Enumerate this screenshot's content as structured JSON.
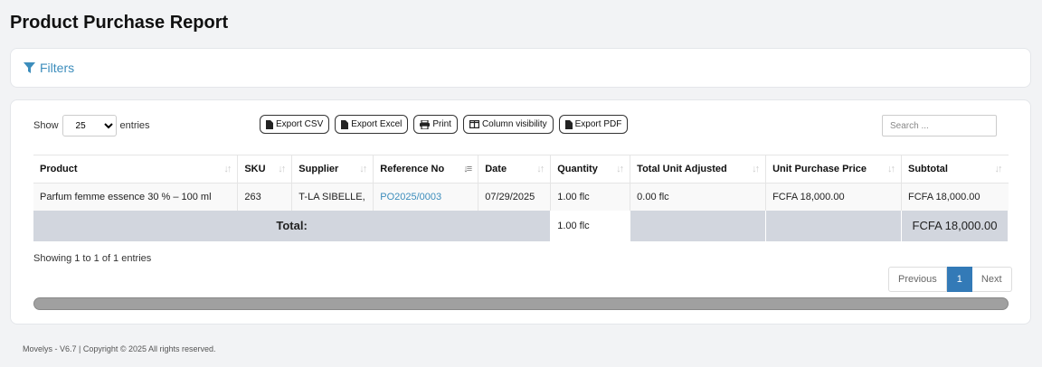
{
  "page": {
    "title": "Product Purchase Report"
  },
  "filters": {
    "label": "Filters"
  },
  "length": {
    "show": "Show",
    "value": "25",
    "entries": "entries"
  },
  "buttons": {
    "csv": "Export CSV",
    "excel": "Export Excel",
    "print": "Print",
    "colvis": "Column visibility",
    "pdf": "Export PDF"
  },
  "search": {
    "placeholder": "Search ..."
  },
  "table": {
    "headers": [
      "Product",
      "SKU",
      "Supplier",
      "Reference No",
      "Date",
      "Quantity",
      "Total Unit Adjusted",
      "Unit Purchase Price",
      "Subtotal"
    ],
    "rows": [
      {
        "product": "Parfum femme essence 30 % – 100 ml",
        "sku": "263",
        "supplier": "T-LA SIBELLE,",
        "ref": "PO2025/0003",
        "date": "07/29/2025",
        "quantity": "1.00 flc",
        "adjusted": "0.00 flc",
        "price": "FCFA 18,000.00",
        "subtotal": "FCFA 18,000.00"
      }
    ],
    "total": {
      "label": "Total:",
      "quantity": "1.00 flc",
      "subtotal": "FCFA 18,000.00"
    }
  },
  "info": "Showing 1 to 1 of 1 entries",
  "pagination": {
    "previous": "Previous",
    "current": "1",
    "next": "Next"
  },
  "footer": "Movelys - V6.7 | Copyright © 2025 All rights reserved."
}
